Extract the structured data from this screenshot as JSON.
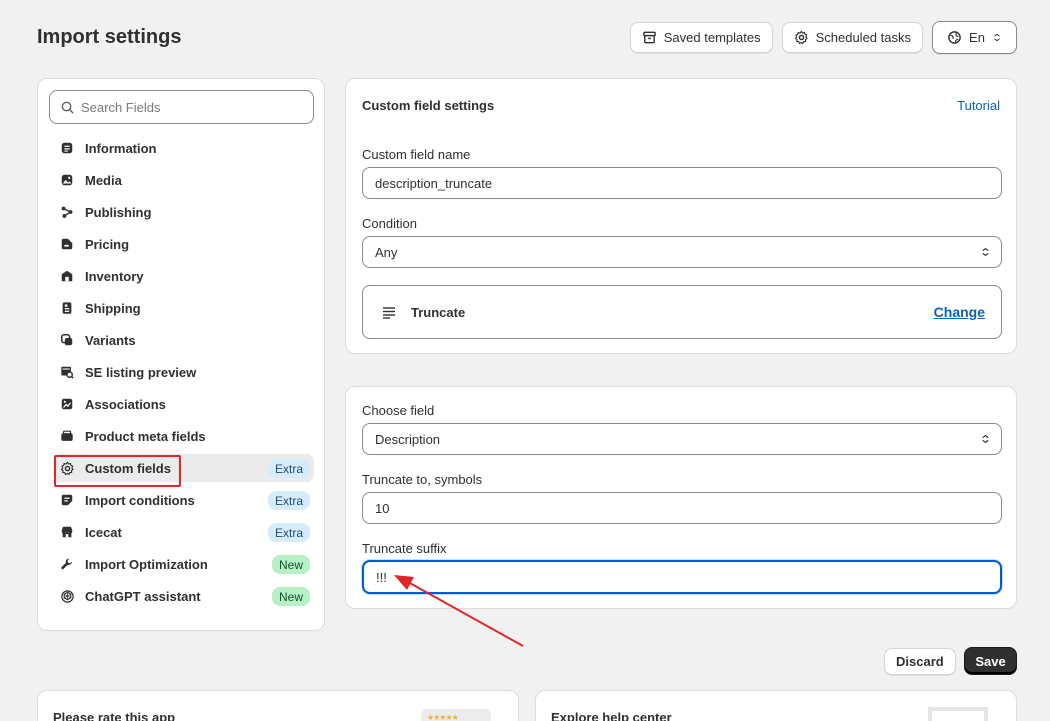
{
  "page": {
    "title": "Import settings"
  },
  "header": {
    "saved_templates": "Saved templates",
    "scheduled_tasks": "Scheduled tasks",
    "language": "En"
  },
  "sidebar": {
    "search_placeholder": "Search Fields",
    "items": [
      {
        "label": "Information",
        "icon": "info-icon"
      },
      {
        "label": "Media",
        "icon": "image-icon"
      },
      {
        "label": "Publishing",
        "icon": "share-icon"
      },
      {
        "label": "Pricing",
        "icon": "price-tag-icon"
      },
      {
        "label": "Inventory",
        "icon": "warehouse-icon"
      },
      {
        "label": "Shipping",
        "icon": "truck-icon"
      },
      {
        "label": "Variants",
        "icon": "variants-icon"
      },
      {
        "label": "SE listing preview",
        "icon": "seo-icon"
      },
      {
        "label": "Associations",
        "icon": "link-icon"
      },
      {
        "label": "Product meta fields",
        "icon": "meta-icon"
      },
      {
        "label": "Custom fields",
        "icon": "gear-icon",
        "badge": "Extra"
      },
      {
        "label": "Import conditions",
        "icon": "conditions-icon",
        "badge": "Extra"
      },
      {
        "label": "Icecat",
        "icon": "store-icon",
        "badge": "Extra"
      },
      {
        "label": "Import Optimization",
        "icon": "wrench-icon",
        "badge": "New"
      },
      {
        "label": "ChatGPT assistant",
        "icon": "ai-icon",
        "badge": "New"
      }
    ]
  },
  "settings": {
    "title": "Custom field settings",
    "tutorial": "Tutorial",
    "name_label": "Custom field name",
    "name_value": "description_truncate",
    "condition_label": "Condition",
    "condition_value": "Any",
    "function_name": "Truncate",
    "change": "Change"
  },
  "truncate": {
    "choose_label": "Choose field",
    "choose_value": "Description",
    "symbols_label": "Truncate to, symbols",
    "symbols_value": "10",
    "suffix_label": "Truncate suffix",
    "suffix_value": "!!!"
  },
  "actions": {
    "discard": "Discard",
    "save": "Save"
  },
  "bottom": {
    "rate_title": "Please rate this app",
    "help_title": "Explore help center",
    "stars": "★★★★★"
  },
  "colors": {
    "accent": "#0a62b8",
    "annotation": "#e0262b",
    "focus": "#005bd3"
  }
}
